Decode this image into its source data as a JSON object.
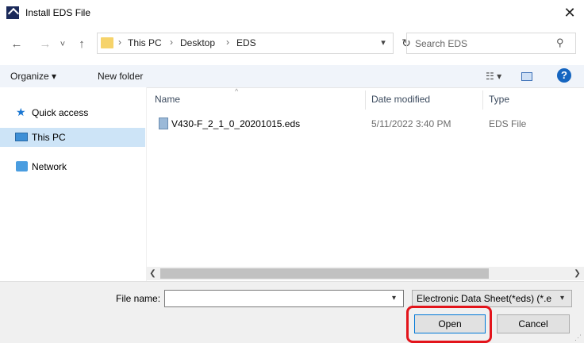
{
  "window": {
    "title": "Install EDS File",
    "close_icon": "close-icon"
  },
  "nav": {
    "back": "←",
    "forward": "→",
    "recent": "˅",
    "up": "↑",
    "breadcrumb": [
      "This PC",
      "Desktop",
      "EDS"
    ],
    "separator": "›",
    "refresh": "↻",
    "search_placeholder": "Search EDS"
  },
  "toolbar": {
    "organize": "Organize ▾",
    "new_folder": "New folder"
  },
  "sidebar": {
    "items": [
      {
        "label": "Quick access",
        "icon": "star-icon"
      },
      {
        "label": "This PC",
        "icon": "computer-icon",
        "selected": true
      },
      {
        "label": "Network",
        "icon": "network-icon"
      }
    ]
  },
  "columns": {
    "name": "Name",
    "date": "Date modified",
    "type": "Type"
  },
  "files": [
    {
      "name": "V430-F_2_1_0_20201015.eds",
      "date": "5/11/2022 3:40 PM",
      "type": "EDS File"
    }
  ],
  "footer": {
    "file_name_label": "File name:",
    "file_name_value": "",
    "file_type": "Electronic Data Sheet(*eds) (*.e",
    "open_label": "Open",
    "cancel_label": "Cancel"
  },
  "colors": {
    "selection": "#cde4f7",
    "highlight": "#e3141b",
    "accent": "#0078d7"
  }
}
